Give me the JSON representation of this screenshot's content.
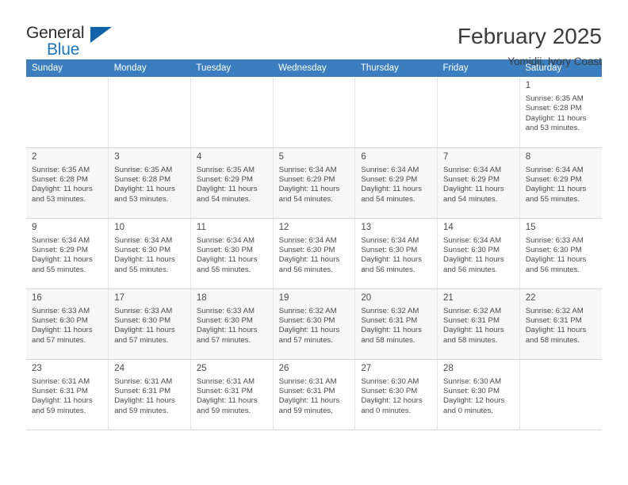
{
  "brand": {
    "name_part1": "General",
    "name_part2": "Blue",
    "logo_icon": "triangle-logo-icon"
  },
  "header": {
    "month_title": "February 2025",
    "location": "Yomidji, Ivory Coast"
  },
  "colors": {
    "header_row": "#3a7ec0",
    "brand_blue": "#1877c4",
    "logo_blue": "#1063a8",
    "alt_row": "#f7f7f7",
    "text": "#4a4a4a"
  },
  "weekdays": [
    "Sunday",
    "Monday",
    "Tuesday",
    "Wednesday",
    "Thursday",
    "Friday",
    "Saturday"
  ],
  "labels": {
    "sunrise": "Sunrise:",
    "sunset": "Sunset:",
    "daylight": "Daylight:"
  },
  "weeks": [
    [
      {
        "empty": true
      },
      {
        "empty": true
      },
      {
        "empty": true
      },
      {
        "empty": true
      },
      {
        "empty": true
      },
      {
        "empty": true
      },
      {
        "day": "1",
        "sunrise": "Sunrise: 6:35 AM",
        "sunset": "Sunset: 6:28 PM",
        "daylight_line1": "Daylight: 11 hours",
        "daylight_line2": "and 53 minutes."
      }
    ],
    [
      {
        "day": "2",
        "sunrise": "Sunrise: 6:35 AM",
        "sunset": "Sunset: 6:28 PM",
        "daylight_line1": "Daylight: 11 hours",
        "daylight_line2": "and 53 minutes."
      },
      {
        "day": "3",
        "sunrise": "Sunrise: 6:35 AM",
        "sunset": "Sunset: 6:28 PM",
        "daylight_line1": "Daylight: 11 hours",
        "daylight_line2": "and 53 minutes."
      },
      {
        "day": "4",
        "sunrise": "Sunrise: 6:35 AM",
        "sunset": "Sunset: 6:29 PM",
        "daylight_line1": "Daylight: 11 hours",
        "daylight_line2": "and 54 minutes."
      },
      {
        "day": "5",
        "sunrise": "Sunrise: 6:34 AM",
        "sunset": "Sunset: 6:29 PM",
        "daylight_line1": "Daylight: 11 hours",
        "daylight_line2": "and 54 minutes."
      },
      {
        "day": "6",
        "sunrise": "Sunrise: 6:34 AM",
        "sunset": "Sunset: 6:29 PM",
        "daylight_line1": "Daylight: 11 hours",
        "daylight_line2": "and 54 minutes."
      },
      {
        "day": "7",
        "sunrise": "Sunrise: 6:34 AM",
        "sunset": "Sunset: 6:29 PM",
        "daylight_line1": "Daylight: 11 hours",
        "daylight_line2": "and 54 minutes."
      },
      {
        "day": "8",
        "sunrise": "Sunrise: 6:34 AM",
        "sunset": "Sunset: 6:29 PM",
        "daylight_line1": "Daylight: 11 hours",
        "daylight_line2": "and 55 minutes."
      }
    ],
    [
      {
        "day": "9",
        "sunrise": "Sunrise: 6:34 AM",
        "sunset": "Sunset: 6:29 PM",
        "daylight_line1": "Daylight: 11 hours",
        "daylight_line2": "and 55 minutes."
      },
      {
        "day": "10",
        "sunrise": "Sunrise: 6:34 AM",
        "sunset": "Sunset: 6:30 PM",
        "daylight_line1": "Daylight: 11 hours",
        "daylight_line2": "and 55 minutes."
      },
      {
        "day": "11",
        "sunrise": "Sunrise: 6:34 AM",
        "sunset": "Sunset: 6:30 PM",
        "daylight_line1": "Daylight: 11 hours",
        "daylight_line2": "and 55 minutes."
      },
      {
        "day": "12",
        "sunrise": "Sunrise: 6:34 AM",
        "sunset": "Sunset: 6:30 PM",
        "daylight_line1": "Daylight: 11 hours",
        "daylight_line2": "and 56 minutes."
      },
      {
        "day": "13",
        "sunrise": "Sunrise: 6:34 AM",
        "sunset": "Sunset: 6:30 PM",
        "daylight_line1": "Daylight: 11 hours",
        "daylight_line2": "and 56 minutes."
      },
      {
        "day": "14",
        "sunrise": "Sunrise: 6:34 AM",
        "sunset": "Sunset: 6:30 PM",
        "daylight_line1": "Daylight: 11 hours",
        "daylight_line2": "and 56 minutes."
      },
      {
        "day": "15",
        "sunrise": "Sunrise: 6:33 AM",
        "sunset": "Sunset: 6:30 PM",
        "daylight_line1": "Daylight: 11 hours",
        "daylight_line2": "and 56 minutes."
      }
    ],
    [
      {
        "day": "16",
        "sunrise": "Sunrise: 6:33 AM",
        "sunset": "Sunset: 6:30 PM",
        "daylight_line1": "Daylight: 11 hours",
        "daylight_line2": "and 57 minutes."
      },
      {
        "day": "17",
        "sunrise": "Sunrise: 6:33 AM",
        "sunset": "Sunset: 6:30 PM",
        "daylight_line1": "Daylight: 11 hours",
        "daylight_line2": "and 57 minutes."
      },
      {
        "day": "18",
        "sunrise": "Sunrise: 6:33 AM",
        "sunset": "Sunset: 6:30 PM",
        "daylight_line1": "Daylight: 11 hours",
        "daylight_line2": "and 57 minutes."
      },
      {
        "day": "19",
        "sunrise": "Sunrise: 6:32 AM",
        "sunset": "Sunset: 6:30 PM",
        "daylight_line1": "Daylight: 11 hours",
        "daylight_line2": "and 57 minutes."
      },
      {
        "day": "20",
        "sunrise": "Sunrise: 6:32 AM",
        "sunset": "Sunset: 6:31 PM",
        "daylight_line1": "Daylight: 11 hours",
        "daylight_line2": "and 58 minutes."
      },
      {
        "day": "21",
        "sunrise": "Sunrise: 6:32 AM",
        "sunset": "Sunset: 6:31 PM",
        "daylight_line1": "Daylight: 11 hours",
        "daylight_line2": "and 58 minutes."
      },
      {
        "day": "22",
        "sunrise": "Sunrise: 6:32 AM",
        "sunset": "Sunset: 6:31 PM",
        "daylight_line1": "Daylight: 11 hours",
        "daylight_line2": "and 58 minutes."
      }
    ],
    [
      {
        "day": "23",
        "sunrise": "Sunrise: 6:31 AM",
        "sunset": "Sunset: 6:31 PM",
        "daylight_line1": "Daylight: 11 hours",
        "daylight_line2": "and 59 minutes."
      },
      {
        "day": "24",
        "sunrise": "Sunrise: 6:31 AM",
        "sunset": "Sunset: 6:31 PM",
        "daylight_line1": "Daylight: 11 hours",
        "daylight_line2": "and 59 minutes."
      },
      {
        "day": "25",
        "sunrise": "Sunrise: 6:31 AM",
        "sunset": "Sunset: 6:31 PM",
        "daylight_line1": "Daylight: 11 hours",
        "daylight_line2": "and 59 minutes."
      },
      {
        "day": "26",
        "sunrise": "Sunrise: 6:31 AM",
        "sunset": "Sunset: 6:31 PM",
        "daylight_line1": "Daylight: 11 hours",
        "daylight_line2": "and 59 minutes."
      },
      {
        "day": "27",
        "sunrise": "Sunrise: 6:30 AM",
        "sunset": "Sunset: 6:30 PM",
        "daylight_line1": "Daylight: 12 hours",
        "daylight_line2": "and 0 minutes."
      },
      {
        "day": "28",
        "sunrise": "Sunrise: 6:30 AM",
        "sunset": "Sunset: 6:30 PM",
        "daylight_line1": "Daylight: 12 hours",
        "daylight_line2": "and 0 minutes."
      },
      {
        "empty": true
      }
    ]
  ]
}
